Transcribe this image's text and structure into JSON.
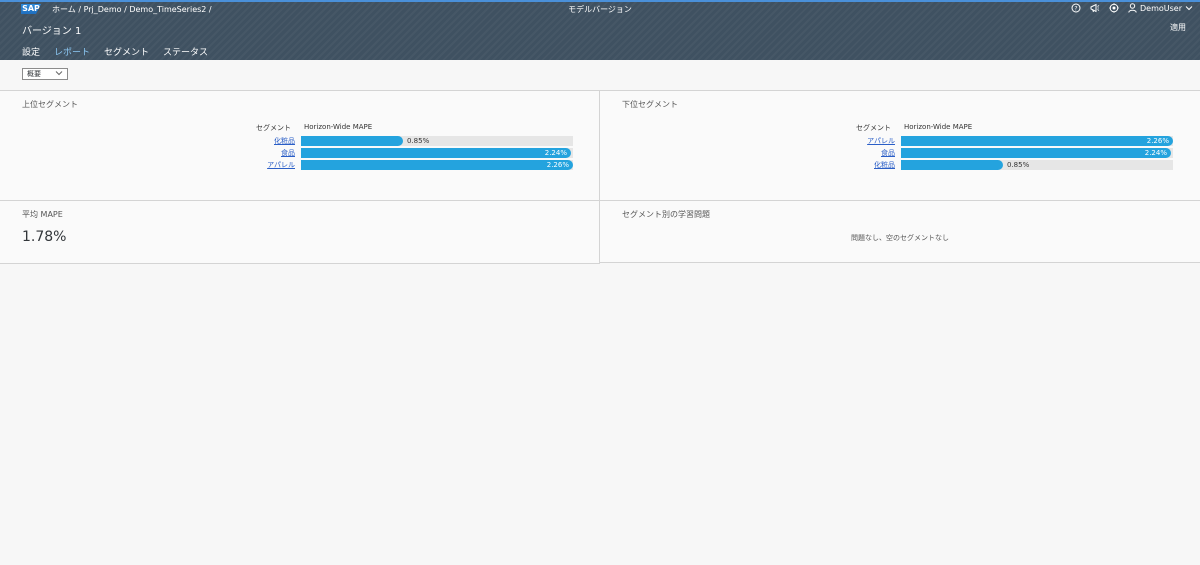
{
  "header": {
    "logo": "SAP",
    "breadcrumb": [
      "ホーム",
      "/",
      "Prj_Demo",
      "/",
      "Demo_TimeSeries2",
      "/"
    ],
    "window_title": "モデルバージョン",
    "user": "DemoUser",
    "version_title": "バージョン 1",
    "apply_label": "適用"
  },
  "tabs": [
    {
      "label": "設定",
      "active": false
    },
    {
      "label": "レポート",
      "active": true
    },
    {
      "label": "セグメント",
      "active": false
    },
    {
      "label": "ステータス",
      "active": false
    }
  ],
  "view_select": {
    "value": "概要"
  },
  "top_segments": {
    "title": "上位セグメント",
    "col_segment": "セグメント",
    "col_metric": "Horizon-Wide MAPE",
    "max": 2.26,
    "rows": [
      {
        "label": "化粧品",
        "value": 0.85,
        "text": "0.85%"
      },
      {
        "label": "食品",
        "value": 2.24,
        "text": "2.24%"
      },
      {
        "label": "アパレル",
        "value": 2.26,
        "text": "2.26%"
      }
    ]
  },
  "bottom_segments": {
    "title": "下位セグメント",
    "col_segment": "セグメント",
    "col_metric": "Horizon-Wide MAPE",
    "max": 2.26,
    "rows": [
      {
        "label": "アパレル",
        "value": 2.26,
        "text": "2.26%"
      },
      {
        "label": "食品",
        "value": 2.24,
        "text": "2.24%"
      },
      {
        "label": "化粧品",
        "value": 0.85,
        "text": "0.85%"
      }
    ]
  },
  "avg_mape": {
    "title": "平均 MAPE",
    "value": "1.78%"
  },
  "learning_issues": {
    "title": "セグメント別の学習問題",
    "message": "問題なし、空のセグメントなし"
  },
  "colors": {
    "bar": "#24a3de",
    "track": "#e6e6e6",
    "shell": "#3f5161",
    "active_tab": "#8cc8f4"
  }
}
